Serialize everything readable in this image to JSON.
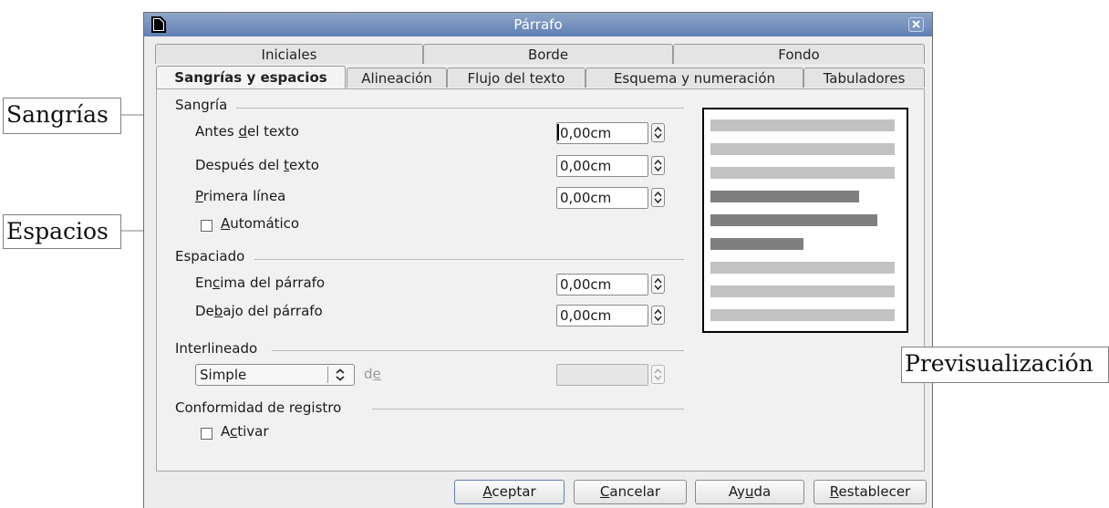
{
  "window": {
    "title": "Párrafo"
  },
  "tabs_row1": [
    {
      "label": "Iniciales"
    },
    {
      "label": "Borde"
    },
    {
      "label": "Fondo"
    }
  ],
  "tabs_row2": [
    {
      "label": "Sangrías y espacios",
      "active": true
    },
    {
      "label": "Alineación"
    },
    {
      "label": "Flujo del texto"
    },
    {
      "label": "Esquema y numeración"
    },
    {
      "label": "Tabuladores"
    }
  ],
  "indent": {
    "section_label": "Sangría",
    "before_label_pre": "Antes ",
    "before_label_u": "d",
    "before_label_post": "el texto",
    "before_value": "0,00cm",
    "after_label_pre": "Después del ",
    "after_label_u": "t",
    "after_label_post": "exto",
    "after_value": "0,00cm",
    "first_label_u": "P",
    "first_label_post": "rimera línea",
    "first_value": "0,00cm",
    "auto_label_u": "A",
    "auto_label_post": "utomático",
    "auto_checked": false
  },
  "spacing": {
    "section_label": "Espaciado",
    "above_label_pre": "En",
    "above_label_u": "c",
    "above_label_post": "ima del párrafo",
    "above_value": "0,00cm",
    "below_label_pre": "De",
    "below_label_u": "b",
    "below_label_post": "ajo del párrafo",
    "below_value": "0,00cm"
  },
  "line_spacing": {
    "section_label": "Interlineado",
    "selected": "Simple",
    "of_label_pre": "d",
    "of_label_u": "e",
    "of_value": ""
  },
  "register": {
    "section_label": "Conformidad de registro",
    "activate_label_pre": "A",
    "activate_label_u": "c",
    "activate_label_post": "tivar",
    "checked": false
  },
  "buttons": {
    "ok_u": "A",
    "ok_post": "ceptar",
    "cancel_u": "C",
    "cancel_post": "ancelar",
    "help_pre": "Ay",
    "help_u": "u",
    "help_post": "da",
    "reset_u": "R",
    "reset_post": "establecer"
  },
  "callouts": {
    "sangrias": "Sangrías",
    "espacios": "Espacios",
    "preview": "Previsualización"
  },
  "colors": {
    "titlebar": "#6f8cbd",
    "preview_light": "#c2c2c2",
    "preview_dark": "#7f7f7f"
  }
}
